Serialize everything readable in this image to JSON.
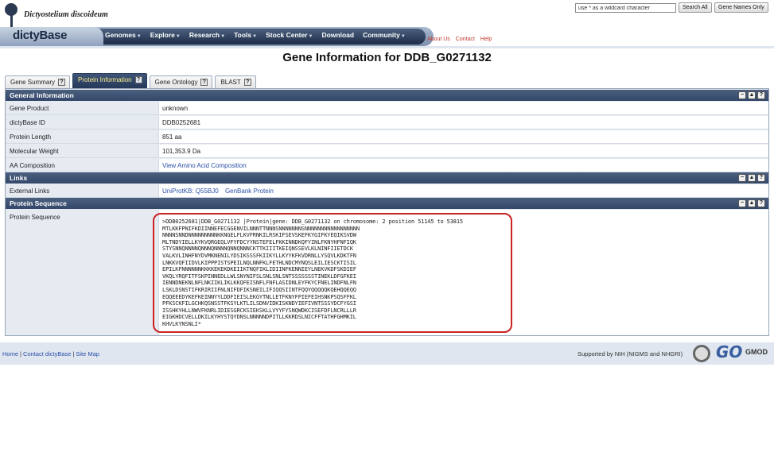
{
  "header": {
    "species": "Dictyostelium discoideum",
    "brand": "dictyBase",
    "nav": [
      {
        "label": "Genomes",
        "caret": true
      },
      {
        "label": "Explore",
        "caret": true
      },
      {
        "label": "Research",
        "caret": true
      },
      {
        "label": "Tools",
        "caret": true
      },
      {
        "label": "Stock Center",
        "caret": true
      },
      {
        "label": "Download",
        "caret": false
      },
      {
        "label": "Community",
        "caret": true
      }
    ],
    "top_links": [
      "About Us",
      "Contact",
      "Help"
    ],
    "search": {
      "value": "use * as a wildcard character",
      "search_all_label": "Search All",
      "gene_names_label": "Gene Names Only"
    }
  },
  "page_title": "Gene Information for DDB_G0271132",
  "tabs": [
    {
      "label": "Gene Summary",
      "active": false
    },
    {
      "label": "Protein Information",
      "active": true
    },
    {
      "label": "Gene Ontology",
      "active": false
    },
    {
      "label": "BLAST",
      "active": false
    }
  ],
  "help_glyph": "?",
  "section_icons": [
    "−",
    "▲",
    "?"
  ],
  "general": {
    "title": "General Information",
    "rows": [
      {
        "label": "Gene Product",
        "value": "unknown"
      },
      {
        "label": "dictyBase ID",
        "value": "DDB0252681"
      },
      {
        "label": "Protein Length",
        "value": "851 aa"
      },
      {
        "label": "Molecular Weight",
        "value": "101,353.9 Da"
      },
      {
        "label": "AA Composition",
        "value": "View Amino Acid Composition"
      }
    ]
  },
  "links": {
    "title": "Links",
    "label": "External Links",
    "uniprot": "UniProtKB: Q55BJ0",
    "genbank": "GenBank Protein"
  },
  "sequence": {
    "title": "Protein Sequence",
    "label": "Protein Sequence",
    "header": ">DDB0252681|DDB_G0271132 |Protein|gene: DDB_G0271132 on chromosome: 2 position 51145 to 53815",
    "lines": [
      "MTLKKFPNIFKDIINNEFECGGENVILNNNTTNNNSNNNNNNNSNNNNNNNNNNNNNNNNN",
      "NNNNSNNDNNNNNNNNNKKNGELFLKVFRNKILRSKIFSEVSKEFKYGIFKYEQIKSVDW",
      "MLTNDYIELLKYKVQRGEQLVFYFDCYYNSTEFELFKKINNDKQFYINLFKNYHFNFIQK",
      "STYSNNQNNNNQNNNQNNNNQNNQNNNCKTTKIIITKEIQNSSEVLKLNINFIIETDCK",
      "VALKVLINHFNYDVMKNENILYDSIKSSSFKIIKYLLKYYKFKVDRNLLYSQVLKDKTFN",
      "LNKKVQFIIDVLKIPPPISTSPEILNQLNNFKLFETHLNDCMYNQSLEILIESCKTISIL",
      "EPILKFNNNNNNKKKKEKEKDKEIIKTNQFIKLIDIINFKENNIEYLNEKVKDFSKDIEF",
      "VKQLYRQFITFSKPINNEDLLWLSNYNIFSLSNLSNLSNTSSSSSSSTINEKLDFGFKEI",
      "IENNDNEKNLNFLNKIIKLIKLKKQFEISNFLFNFLASIDNLEYFKYCFNELINDFNLFN",
      "LSKLDSNSTIFKRIRIIFNLNIFDFIKSNEILIFIQQSIINTFQQYQQQQQKQEHQQEQQ",
      "EQQEEEDYKEFKEINNYYLDDFIEISLEKGYTNLLETFKNYFPIEFEIHSNKPSQSFFKL",
      "PFKSCKFILGCHKQSNSSTFKSYLKTLILSDNVIDKISKNDYIEFIVNTSSSYDCFYGSI",
      "ISSHKYHLLNWVFKNRLIDIESGRCKSIEKSKLLVYYFYSNQWDKCISEFDFLNCRLLLR",
      "EIGKHDCVELLDKILKYHYSTQYDNSLNNNNNDPITLLKKRDSLNICFFTATHFGHMKIL",
      "KHVLKYNSNLI*"
    ]
  },
  "footer": {
    "links": [
      "Home",
      "Contact dictyBase",
      "Site Map"
    ],
    "support": "Supported by NIH (NIGMS and NHGRI)",
    "go_logo": "GO",
    "gmod_logo": "GMOD"
  }
}
